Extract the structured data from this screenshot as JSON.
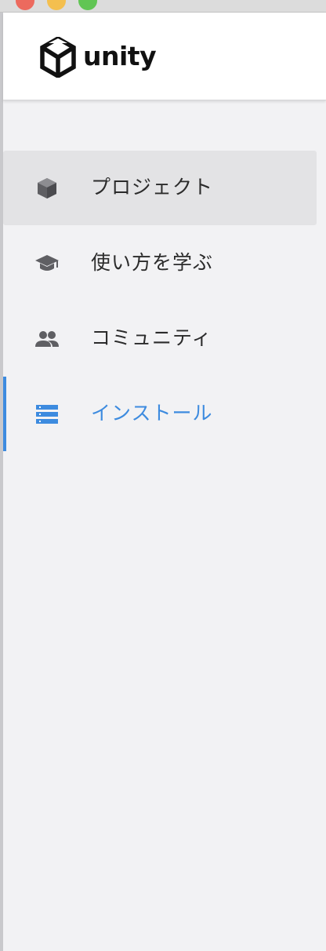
{
  "window": {
    "controls": [
      "close",
      "minimize",
      "zoom"
    ]
  },
  "header": {
    "logo_text": "unity",
    "logo_icon": "unity-cube-icon"
  },
  "sidebar": {
    "items": [
      {
        "label": "プロジェクト",
        "icon": "cube-icon",
        "state": "hovered"
      },
      {
        "label": "使い方を学ぶ",
        "icon": "graduation-cap-icon",
        "state": "normal"
      },
      {
        "label": "コミュニティ",
        "icon": "people-icon",
        "state": "normal"
      },
      {
        "label": "インストール",
        "icon": "server-stack-icon",
        "state": "active"
      }
    ]
  },
  "colors": {
    "accent": "#3d8bdf",
    "icon_gray": "#5f5f63",
    "sidebar_bg": "#f2f2f4",
    "selected_bg": "#e3e3e5",
    "header_bg": "#ffffff"
  }
}
